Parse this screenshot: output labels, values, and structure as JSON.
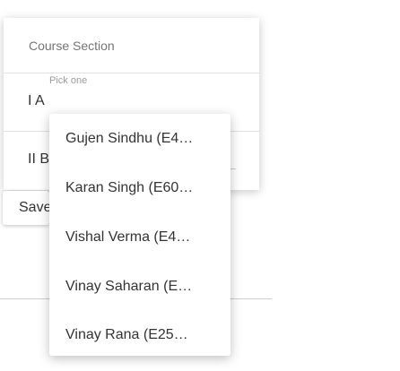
{
  "card": {
    "header": "Course Section",
    "pick_label": "Pick one",
    "sections": [
      "I A",
      "II B"
    ]
  },
  "save_label": "Save",
  "dropdown": {
    "options": [
      "Gujen Sindhu (E4…",
      "Karan Singh (E60…",
      "Vishal Verma (E4…",
      "Vinay Saharan (E…",
      "Vinay Rana (E25…"
    ]
  }
}
